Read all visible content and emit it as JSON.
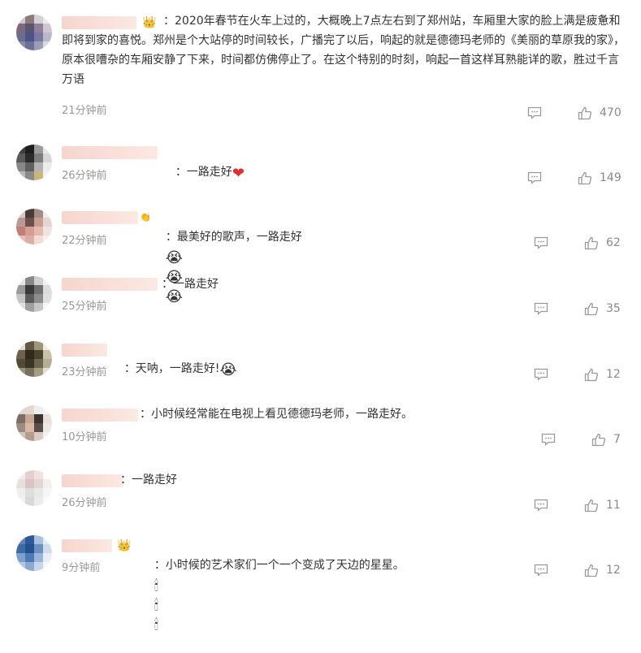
{
  "comments": [
    {
      "text": "：2020年春节在火车上过的，大概晚上7点左右到了郑州站，车厢里大家的脸上满是疲惫和即将到家的喜悦。郑州是个大站停的时间较长，广播完了以后，响起的就是德德玛老师的《美丽的草原我的家》，原本很嘈杂的车厢安静了下来，时间都仿佛停止了。在这个特别的时刻，响起一首这样耳熟能详的歌，胜过千言万语",
      "emoji": [],
      "time": "21分钟前",
      "likes": "470",
      "badge": "crown-emoji"
    },
    {
      "text": "：一路走好",
      "emoji": [
        "❤"
      ],
      "time": "26分钟前",
      "likes": "149"
    },
    {
      "text": "：最美好的歌声，一路走好",
      "emoji": [
        "😭",
        "😭",
        "😭"
      ],
      "time": "22分钟前",
      "likes": "62"
    },
    {
      "text": "：一路走好",
      "emoji": [],
      "time": "25分钟前",
      "likes": "35"
    },
    {
      "text": "：天呐，一路走好!",
      "emoji": [
        "😭"
      ],
      "time": "23分钟前",
      "likes": "12"
    },
    {
      "text": "：小时候经常能在电视上看见德德玛老师，一路走好。",
      "emoji": [],
      "time": "10分钟前",
      "likes": "7"
    },
    {
      "text": "：一路走好",
      "emoji": [],
      "time": "26分钟前",
      "likes": "11"
    },
    {
      "text": "：小时候的艺术家们一个一个变成了天边的星星。",
      "emoji": [
        "🕯",
        "🕯",
        "🕯"
      ],
      "time": "9分钟前",
      "likes": "12",
      "badge": "crown-emoji"
    }
  ],
  "colors": {
    "text": "#333333",
    "meta": "#999999",
    "username_blur": "#f6d6cf"
  },
  "icons": {
    "reply": "comment-bubble-icon",
    "like": "thumbs-up-icon"
  }
}
